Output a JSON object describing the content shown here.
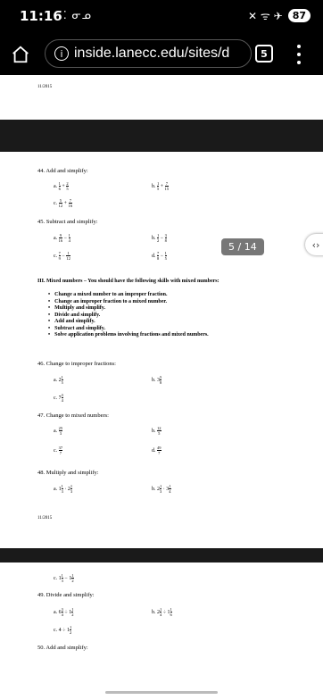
{
  "status_bar": {
    "time": "11:16",
    "notification_icons": "⁚⁚ ᓂᓄ",
    "signal_icons": "✕ ᯤ ✈",
    "battery": "87"
  },
  "browser": {
    "url": "inside.lanecc.edu/sites/d",
    "tab_count": "5"
  },
  "pdf": {
    "page_indicator": "5 / 14",
    "date_top": "11/2015",
    "date_bottom": "11/2015",
    "q44_title": "44. Add and simplify:",
    "q45_title": "45. Subtract and simplify:",
    "section3_title": "III. Mixed numbers – You should have the following skills with mixed numbers:",
    "skills": [
      "Change a mixed number to an improper fraction.",
      "Change an improper fraction to a mixed number.",
      "Multiply and simplify.",
      "Divide and simplify.",
      "Add and simplify.",
      "Subtract and simplify.",
      "Solve application problems involving fractions and mixed numbers."
    ],
    "q46_title": "46. Change to improper fractions:",
    "q47_title": "47. Change to mixed numbers:",
    "q48_title": "48. Multiply and simplify:",
    "q49_title": "49. Divide and simplify:",
    "q50_title": "50. Add and simplify:",
    "labels": {
      "a": "a.",
      "b": "b.",
      "c": "c.",
      "d": "d."
    },
    "ops": {
      "plus": "+",
      "minus": "−",
      "times": "·",
      "div": "÷"
    },
    "q44": {
      "a": [
        [
          "1",
          "6"
        ],
        [
          "2",
          "5"
        ]
      ],
      "b": [
        [
          "1",
          "5"
        ],
        [
          "7",
          "15"
        ]
      ],
      "c": [
        [
          "5",
          "12"
        ],
        [
          "7",
          "16"
        ]
      ]
    },
    "q45": {
      "a": [
        [
          "9",
          "16"
        ],
        [
          "1",
          "4"
        ]
      ],
      "b": [
        [
          "1",
          "2"
        ],
        [
          "3",
          "8"
        ]
      ],
      "c": [
        [
          "7",
          "9"
        ],
        [
          "1",
          "12"
        ]
      ],
      "d": [
        [
          "7",
          "8"
        ],
        [
          "1",
          "5"
        ]
      ]
    },
    "q46": {
      "a": {
        "whole": "2",
        "num": "1",
        "den": "5"
      },
      "b": {
        "whole": "3",
        "num": "5",
        "den": "8"
      },
      "c": {
        "whole": "7",
        "num": "3",
        "den": "4"
      }
    },
    "q47": {
      "a": [
        "25",
        "3"
      ],
      "b": [
        "12",
        "5"
      ],
      "c": [
        "37",
        "7"
      ],
      "d": [
        "49",
        "7"
      ]
    },
    "q48": {
      "a": [
        {
          "whole": "1",
          "num": "1",
          "den": "3"
        },
        {
          "whole": "2",
          "num": "1",
          "den": "3"
        }
      ],
      "b": [
        {
          "whole": "2",
          "num": "1",
          "den": "3"
        },
        {
          "whole": "3",
          "num": "1",
          "den": "4"
        }
      ],
      "c": [
        {
          "whole": "1",
          "num": "1",
          "den": "3"
        },
        {
          "whole": "1",
          "num": "1",
          "den": "2"
        }
      ]
    },
    "q49": {
      "a": [
        {
          "whole": "6",
          "num": "3",
          "den": "4"
        },
        {
          "whole": "1",
          "num": "1",
          "den": "2"
        }
      ],
      "b": [
        {
          "whole": "2",
          "num": "1",
          "den": "4"
        },
        {
          "whole": "1",
          "num": "1",
          "den": "6"
        }
      ],
      "c": [
        {
          "whole": "4",
          "num": "",
          "den": ""
        },
        {
          "whole": "1",
          "num": "1",
          "den": "2"
        }
      ]
    }
  }
}
